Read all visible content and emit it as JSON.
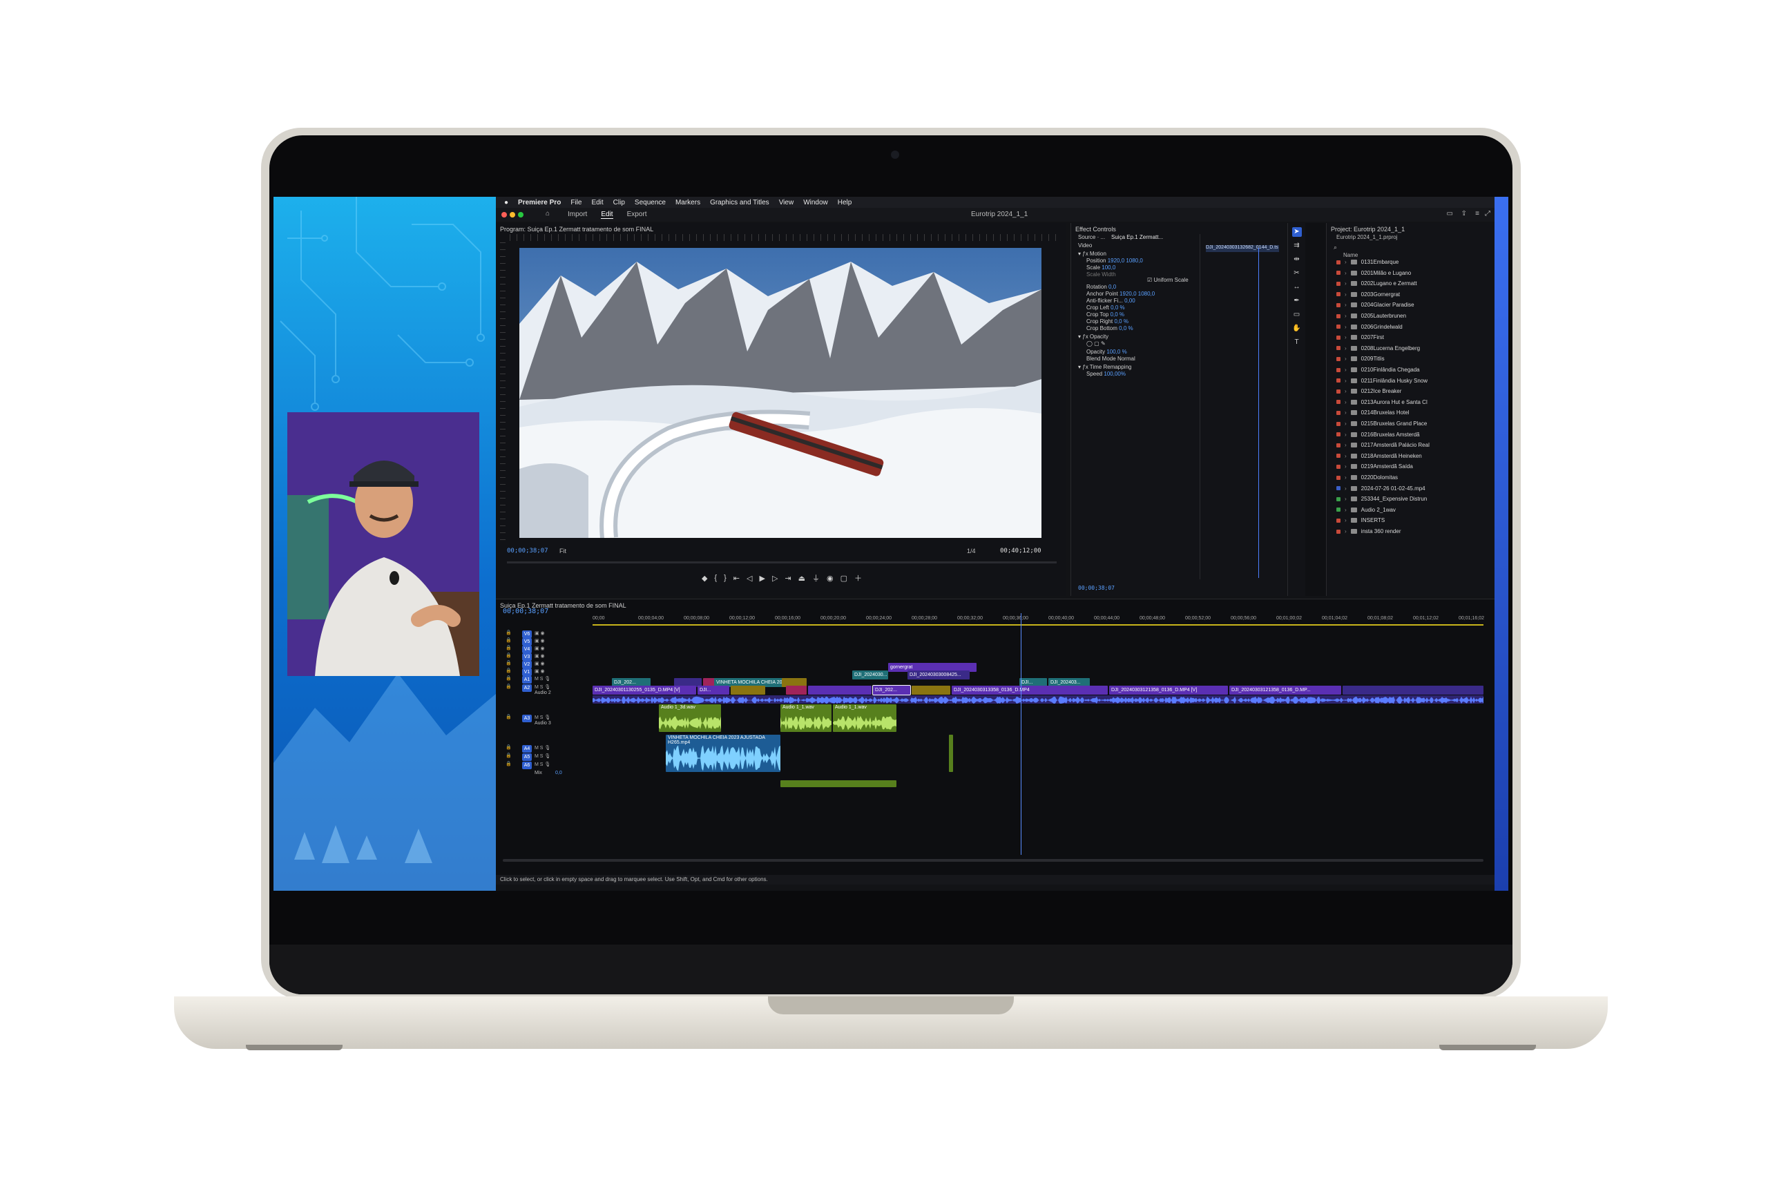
{
  "menu": {
    "app": "Premiere Pro",
    "items": [
      "File",
      "Edit",
      "Clip",
      "Sequence",
      "Markers",
      "Graphics and Titles",
      "View",
      "Window",
      "Help"
    ]
  },
  "workspaces": {
    "import": "Import",
    "edit": "Edit",
    "export": "Export"
  },
  "window_title": "Eurotrip 2024_1_1",
  "program": {
    "title": "Program: Suiça Ep.1 Zermatt tratamento de som FINAL",
    "timecode": "00;00;38;07",
    "fit": "Fit",
    "resolution": "1/4",
    "duration": "00;40;12;00"
  },
  "effect_controls": {
    "title": "Effect Controls",
    "source": "Source · ...",
    "sequence": "Suiça Ep.1 Zermatt...",
    "clip": "DJI_20240303132682_0144_D.ts",
    "section_video": "Video",
    "rows": [
      {
        "name": "Motion",
        "value": ""
      },
      {
        "name": "Position",
        "value": "1920,0   1080,0"
      },
      {
        "name": "Scale",
        "value": "100,0"
      },
      {
        "name": "Scale Width",
        "value": ""
      },
      {
        "name": "Uniform Scale",
        "value": ""
      },
      {
        "name": "Rotation",
        "value": "0,0"
      },
      {
        "name": "Anchor Point",
        "value": "1920,0   1080,0"
      },
      {
        "name": "Anti-flicker Fi...",
        "value": "0,00"
      },
      {
        "name": "Crop Left",
        "value": "0,0 %"
      },
      {
        "name": "Crop Top",
        "value": "0,0 %"
      },
      {
        "name": "Crop Right",
        "value": "0,0 %"
      },
      {
        "name": "Crop Bottom",
        "value": "0,0 %"
      },
      {
        "name": "Opacity",
        "value": ""
      },
      {
        "name": "Opacity",
        "value": "100,0 %"
      },
      {
        "name": "Blend Mode",
        "value": "Normal"
      },
      {
        "name": "Time Remapping",
        "value": ""
      },
      {
        "name": "Speed",
        "value": "100,00%"
      }
    ],
    "footer_tc": "00;00;38;07"
  },
  "project": {
    "title": "Project: Eurotrip 2024_1_1",
    "file": "Eurotrip 2024_1_1.prproj",
    "column": "Name",
    "items": [
      {
        "name": "0131Embarque",
        "color": "#c84a3a"
      },
      {
        "name": "0201Milão e Lugano",
        "color": "#c84a3a"
      },
      {
        "name": "0202Lugano e Zermatt",
        "color": "#c84a3a"
      },
      {
        "name": "0203Gornergrat",
        "color": "#c84a3a"
      },
      {
        "name": "0204Glacier Paradise",
        "color": "#c84a3a"
      },
      {
        "name": "0205Lauterbrunen",
        "color": "#c84a3a"
      },
      {
        "name": "0206Grindelwald",
        "color": "#c84a3a"
      },
      {
        "name": "0207First",
        "color": "#c84a3a"
      },
      {
        "name": "0208Lucerna Engelberg",
        "color": "#c84a3a"
      },
      {
        "name": "0209Titlis",
        "color": "#c84a3a"
      },
      {
        "name": "0210Finlândia Chegada",
        "color": "#c84a3a"
      },
      {
        "name": "0211Finlândia Husky Snow",
        "color": "#c84a3a"
      },
      {
        "name": "0212Ice Breaker",
        "color": "#c84a3a"
      },
      {
        "name": "0213Aurora Hut e Santa Cl",
        "color": "#c84a3a"
      },
      {
        "name": "0214Bruxelas Hotel",
        "color": "#c84a3a"
      },
      {
        "name": "0215Bruxelas Grand Place",
        "color": "#c84a3a"
      },
      {
        "name": "0216Bruxelas Amsterdã",
        "color": "#c84a3a"
      },
      {
        "name": "0217Amsterdã Palácio Real",
        "color": "#c84a3a"
      },
      {
        "name": "0218Amsterdã Heineken",
        "color": "#c84a3a"
      },
      {
        "name": "0219Amsterdã Saída",
        "color": "#c84a3a"
      },
      {
        "name": "0220Dolomitas",
        "color": "#c84a3a"
      },
      {
        "name": "2024-07-26 01-02-45.mp4",
        "color": "#3a5fc8"
      },
      {
        "name": "253344_Expensive Distrun",
        "color": "#3aa04a"
      },
      {
        "name": "Audio 2_1wav",
        "color": "#3aa04a"
      },
      {
        "name": "INSERTS",
        "color": "#c84a3a"
      },
      {
        "name": "insta 360 render",
        "color": "#c84a3a"
      }
    ]
  },
  "timeline": {
    "title": "Suiça Ep.1 Zermatt tratamento de som FINAL",
    "timecode": "00;00;38;07",
    "ruler": [
      "00;00",
      "00;00;04;00",
      "00;00;08;00",
      "00;00;12;00",
      "00;00;16;00",
      "00;00;20;00",
      "00;00;24;00",
      "00;00;28;00",
      "00;00;32;00",
      "00;00;36;00",
      "00;00;40;00",
      "00;00;44;00",
      "00;00;48;00",
      "00;00;52;00",
      "00;00;56;00",
      "00;01;00;02",
      "00;01;04;02",
      "00;01;08;02",
      "00;01;12;02",
      "00;01;16;02"
    ],
    "tracks": [
      "V6",
      "V5",
      "V4",
      "V3",
      "V2",
      "V1",
      "A1",
      "A2",
      "A3",
      "A4",
      "A5",
      "A6"
    ],
    "audio2_label": "Audio 2",
    "audio3_label": "Audio 3",
    "mix_label": "Mix",
    "mix_value": "0,0",
    "clips": {
      "gornergrat": "gornergrat",
      "v1_a": "DJI_20240301130255_0135_D.MP4 [V]",
      "v1_b": "DJI...",
      "v1_c": "DJI_2024030313358_0136_D.MP4",
      "v1_d": "DJI_20240303121358_0136_D.MP4 [V]",
      "v1_e": "DJI_20240303121358_0136_D.MP...",
      "v1_sel": "DJI_202...",
      "vinheta": "VINHETA MOCHILA CHEIA 2023...",
      "v3_a": "DJI_2024030...",
      "v3_b": "DJI_20240303008425...",
      "v2_a": "DJI_202...",
      "v2_b": "DJI...",
      "v2_c": "DJI...",
      "v2_d": "DJI_202403...",
      "a_audio1": "Audio 1_3d.wav",
      "a_audio2": "Audio 1_1.wav",
      "a_audio3": "Audio 1_1.wav",
      "a_vinheta": "VINHETA MOCHILA CHEIA 2023 AJUSTADA H265.mp4"
    }
  },
  "status": "Click to select, or click in empty space and drag to marquee select. Use Shift, Opt, and Cmd for other options.",
  "colors": {
    "accent": "#5a8cff",
    "video_clip": "#5b2fb3",
    "audio_green": "#6f9a2b",
    "audio_blue": "#2f8fd8"
  }
}
